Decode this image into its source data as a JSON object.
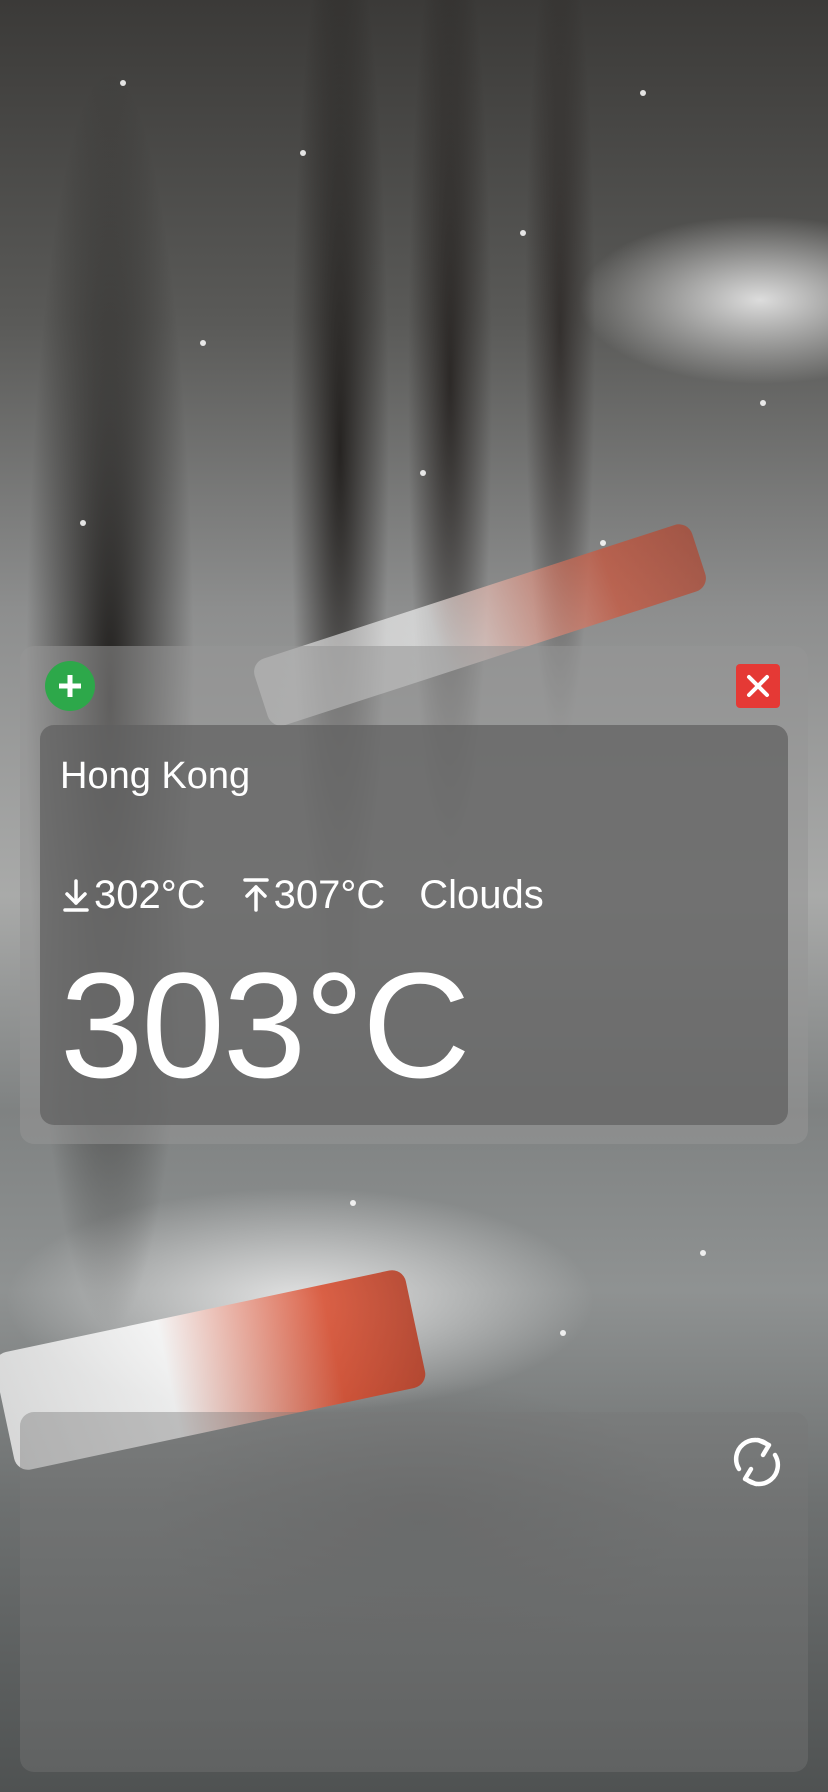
{
  "background": {
    "description_icon": "snowy-park-bench-photo"
  },
  "colors": {
    "add_button": "#2da84a",
    "close_button": "#e53935",
    "text": "#ffffff"
  },
  "weather_card": {
    "add_icon": "plus-icon",
    "close_icon": "close-icon",
    "city": "Hong Kong",
    "min_icon": "arrow-down-to-line-icon",
    "min_temp": "302°C",
    "max_icon": "arrow-up-from-line-icon",
    "max_temp": "307°C",
    "condition": "Clouds",
    "current_temp": "303°C"
  },
  "bottom_card": {
    "refresh_icon": "refresh-icon"
  }
}
